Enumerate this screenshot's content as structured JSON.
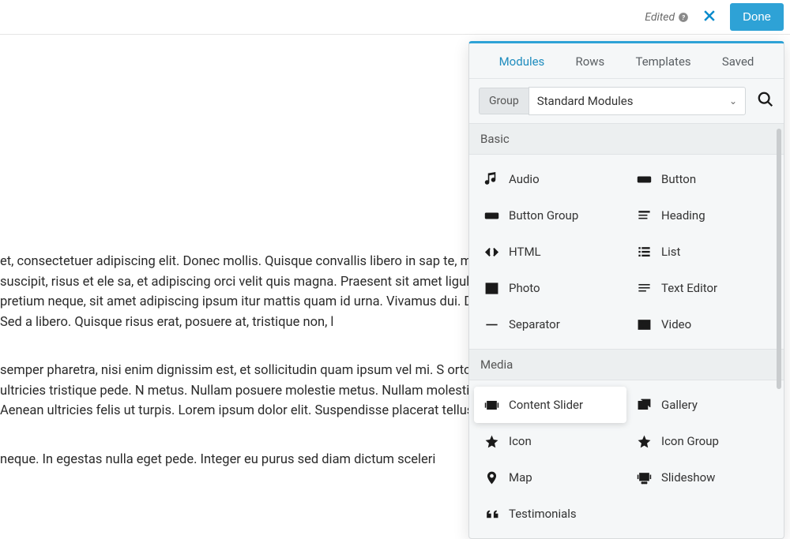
{
  "topbar": {
    "edited_label": "Edited",
    "done_label": "Done"
  },
  "content": {
    "p1": "et, consectetuer adipiscing elit. Donec mollis. Quisque convallis libero in sap te, malesuada id, tempor eu, gravida id, odio. Maecenas suscipit, risus et ele sa, et adipiscing orci velit quis magna. Praesent sit amet ligula id orci venena s non tincidunt dapibus, orci pede pretium neque, sit amet adipiscing ipsum itur mattis quam id urna. Vivamus dui. Donec nonummy lacinia lorem. Cras r llis quis, justo. Sed a libero. Quisque risus erat, posuere at, tristique non, l",
    "p2": "semper pharetra, nisi enim dignissim est, et sollicitudin quam ipsum vel mi. S ortor. Curabitur sodales scelerisque magna. Donec ultricies tristique pede. N metus. Nullam posuere molestie metus. Nullam molestie, nunc id suscipit rh s tortor dolor eget augue. Aenean ultricies felis ut turpis. Lorem ipsum dolor elit. Suspendisse placerat tellus ac nulla. Proin adipiscing sem ac risus. Mae",
    "p3": "neque. In egestas nulla eget pede. Integer eu purus sed diam dictum sceleri"
  },
  "panel": {
    "tabs": [
      "Modules",
      "Rows",
      "Templates",
      "Saved"
    ],
    "active_tab": 0,
    "group_label": "Group",
    "group_value": "Standard Modules",
    "sections": {
      "basic": {
        "title": "Basic",
        "items": [
          {
            "icon": "audio",
            "label": "Audio"
          },
          {
            "icon": "button",
            "label": "Button"
          },
          {
            "icon": "button-group",
            "label": "Button Group"
          },
          {
            "icon": "heading",
            "label": "Heading"
          },
          {
            "icon": "html",
            "label": "HTML"
          },
          {
            "icon": "list",
            "label": "List"
          },
          {
            "icon": "photo",
            "label": "Photo"
          },
          {
            "icon": "text-editor",
            "label": "Text Editor"
          },
          {
            "icon": "separator",
            "label": "Separator"
          },
          {
            "icon": "video",
            "label": "Video"
          }
        ]
      },
      "media": {
        "title": "Media",
        "items": [
          {
            "icon": "content-slider",
            "label": "Content Slider"
          },
          {
            "icon": "gallery",
            "label": "Gallery"
          },
          {
            "icon": "icon",
            "label": "Icon"
          },
          {
            "icon": "icon-group",
            "label": "Icon Group"
          },
          {
            "icon": "map",
            "label": "Map"
          },
          {
            "icon": "slideshow",
            "label": "Slideshow"
          },
          {
            "icon": "testimonials",
            "label": "Testimonials"
          }
        ]
      }
    }
  }
}
